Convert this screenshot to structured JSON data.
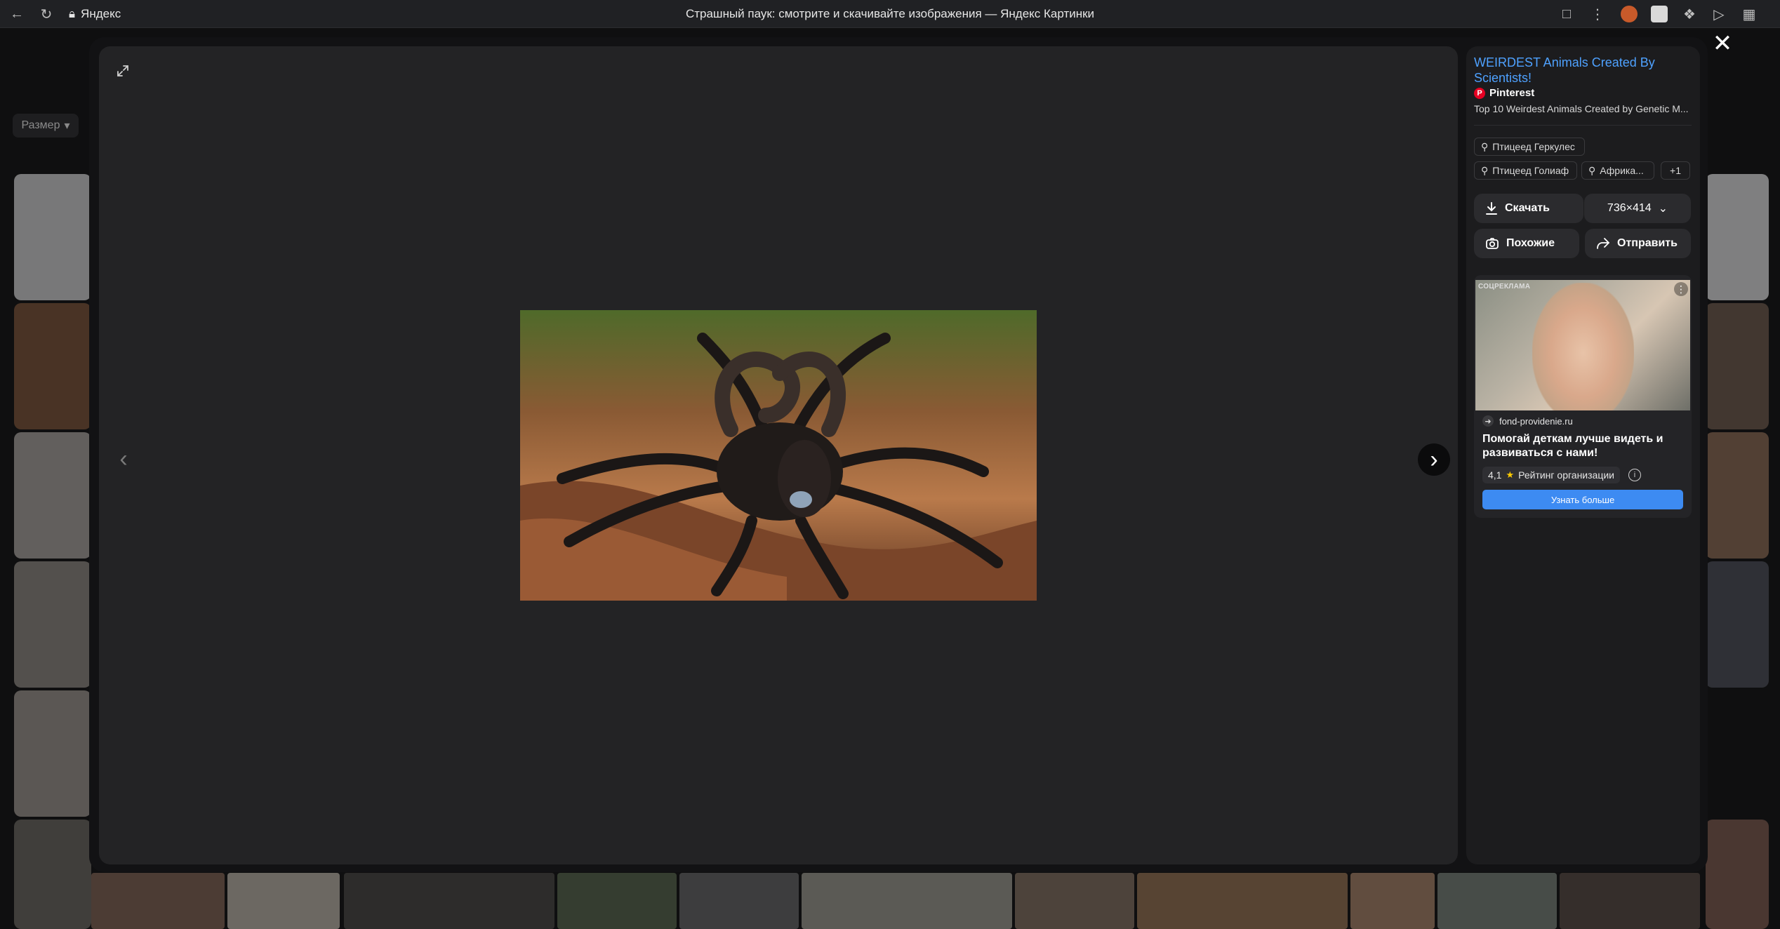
{
  "browser": {
    "address": "Яндекс",
    "page_title": "Страшный паук: смотрите и скачивайте изображения — Яндекс Картинки"
  },
  "background": {
    "filter_label": "Размер"
  },
  "viewer": {
    "image_alt": "tarantula with ram horns"
  },
  "panel": {
    "source_title": "WEIRDEST Animals Created By Scientists!",
    "source_site": "Pinterest",
    "source_description": "Top 10 Weirdest Animals Created by Genetic M...",
    "tags": [
      "Птицеед Геркулес",
      "Птицеед Голиаф",
      "Африка...",
      "+1"
    ],
    "download_label": "Скачать",
    "size_label": "736×414",
    "similar_label": "Похожие",
    "share_label": "Отправить"
  },
  "ad": {
    "label": "СОЦРЕКЛАМА",
    "domain": "fond-providenie.ru",
    "headline": "Помогай деткам лучше видеть и развиваться с нами!",
    "rating": "4,1",
    "rating_label": "Рейтинг организации",
    "cta": "Узнать больше"
  },
  "colors": {
    "accent_link": "#4ea1ff",
    "cta_blue": "#3d8bf2",
    "pinterest": "#e60023"
  }
}
